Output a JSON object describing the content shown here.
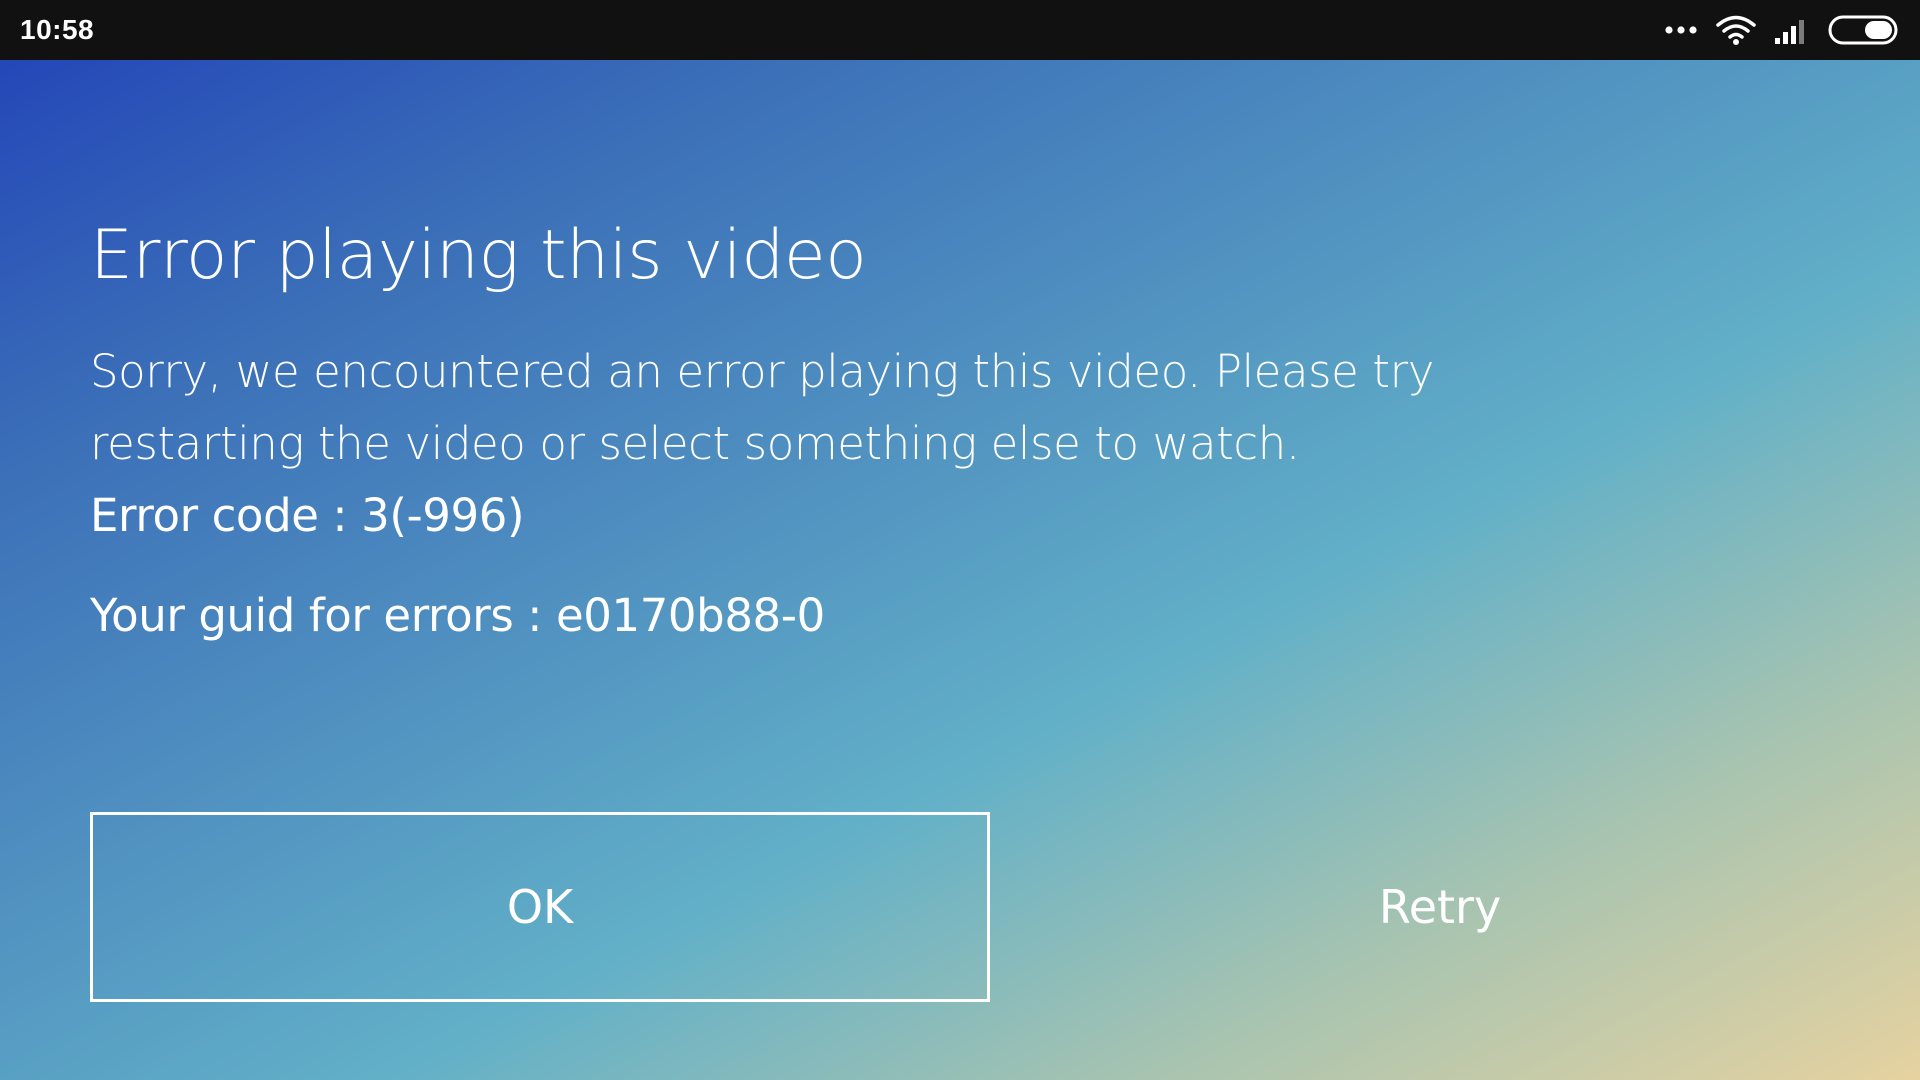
{
  "status_bar": {
    "time": "10:58",
    "background": "#111111",
    "icons": [
      "more-dots-icon",
      "wifi-icon",
      "cellular-signal-icon",
      "battery-icon"
    ]
  },
  "dialog": {
    "title": "Error playing this video",
    "message": "Sorry, we encountered an error playing this video. Please try restarting the video or select something else to watch.",
    "error_code": "Error code : 3(-996)",
    "guid": "Your guid for errors : e0170b88-0",
    "ok_label": "OK",
    "retry_label": "Retry"
  },
  "theme": {
    "gradient_stops": [
      "#2447b8",
      "#3b6fb8",
      "#4f8fc0",
      "#62b0c8",
      "#a8c4b0",
      "#e6d2a0"
    ],
    "text_color": "#ffffff"
  }
}
